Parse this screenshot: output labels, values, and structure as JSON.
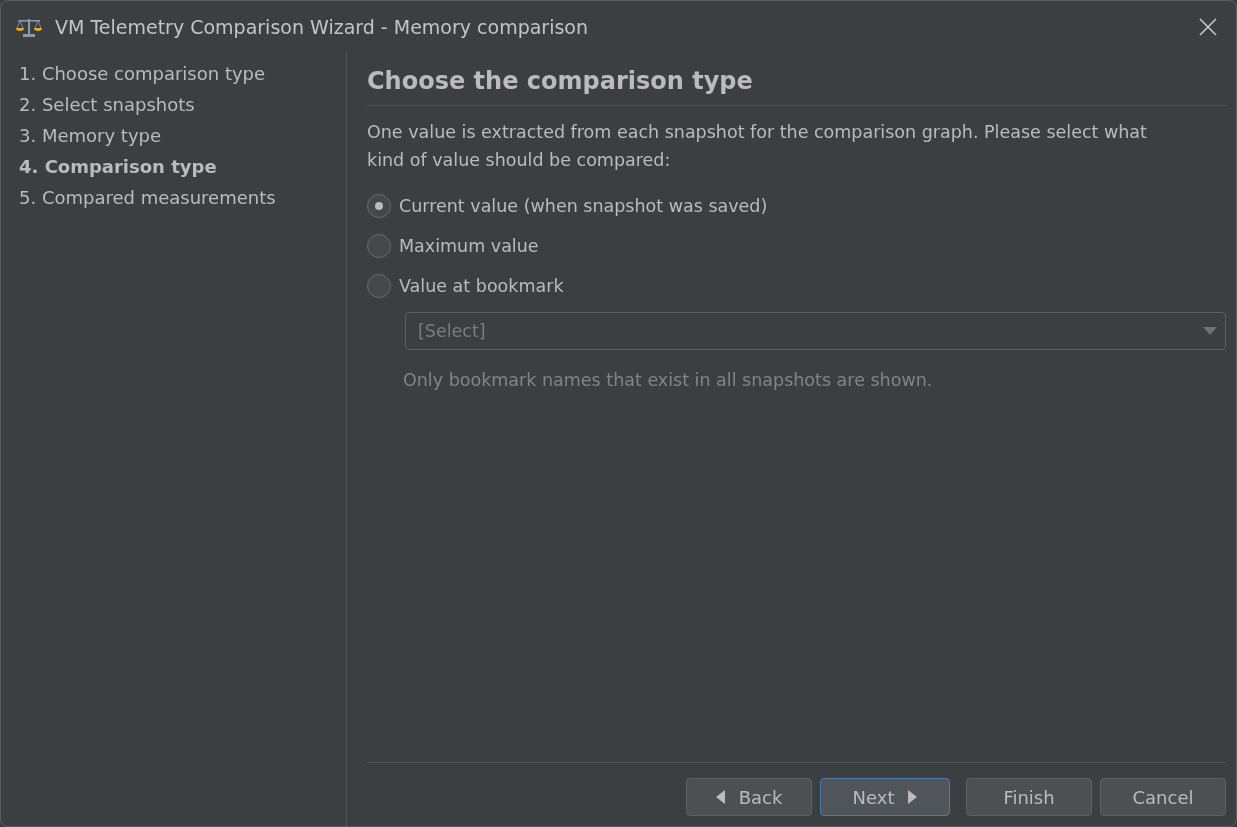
{
  "window": {
    "title": "VM Telemetry Comparison Wizard - Memory comparison"
  },
  "steps": [
    {
      "label": "1. Choose comparison type",
      "selected": false
    },
    {
      "label": "2. Select snapshots",
      "selected": false
    },
    {
      "label": "3. Memory type",
      "selected": false
    },
    {
      "label": "4. Comparison type",
      "selected": true
    },
    {
      "label": "5. Compared measurements",
      "selected": false
    }
  ],
  "heading": "Choose the comparison type",
  "description": "One value is extracted from each snapshot for the comparison graph. Please select what kind of value should be compared:",
  "options": [
    {
      "label": "Current value (when snapshot was saved)",
      "selected": true
    },
    {
      "label": "Maximum value",
      "selected": false
    },
    {
      "label": "Value at bookmark",
      "selected": false
    }
  ],
  "bookmark_select": {
    "placeholder": "[Select]",
    "disabled": true
  },
  "hint": "Only bookmark names that exist in all snapshots are shown.",
  "buttons": [
    {
      "label": "Back",
      "kind": "back",
      "focused": false
    },
    {
      "label": "Next",
      "kind": "next",
      "focused": true
    },
    {
      "label": "Finish",
      "kind": "plain",
      "focused": false
    },
    {
      "label": "Cancel",
      "kind": "plain",
      "focused": false
    }
  ]
}
